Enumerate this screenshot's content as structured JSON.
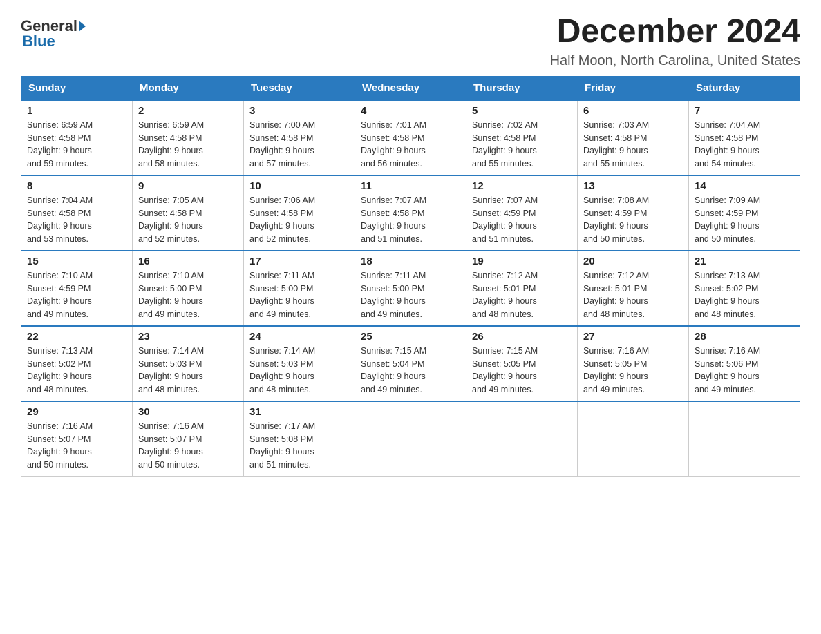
{
  "logo": {
    "general": "General",
    "blue": "Blue"
  },
  "title": {
    "month": "December 2024",
    "location": "Half Moon, North Carolina, United States"
  },
  "days_of_week": [
    "Sunday",
    "Monday",
    "Tuesday",
    "Wednesday",
    "Thursday",
    "Friday",
    "Saturday"
  ],
  "weeks": [
    [
      {
        "day": "1",
        "sunrise": "6:59 AM",
        "sunset": "4:58 PM",
        "daylight": "9 hours and 59 minutes."
      },
      {
        "day": "2",
        "sunrise": "6:59 AM",
        "sunset": "4:58 PM",
        "daylight": "9 hours and 58 minutes."
      },
      {
        "day": "3",
        "sunrise": "7:00 AM",
        "sunset": "4:58 PM",
        "daylight": "9 hours and 57 minutes."
      },
      {
        "day": "4",
        "sunrise": "7:01 AM",
        "sunset": "4:58 PM",
        "daylight": "9 hours and 56 minutes."
      },
      {
        "day": "5",
        "sunrise": "7:02 AM",
        "sunset": "4:58 PM",
        "daylight": "9 hours and 55 minutes."
      },
      {
        "day": "6",
        "sunrise": "7:03 AM",
        "sunset": "4:58 PM",
        "daylight": "9 hours and 55 minutes."
      },
      {
        "day": "7",
        "sunrise": "7:04 AM",
        "sunset": "4:58 PM",
        "daylight": "9 hours and 54 minutes."
      }
    ],
    [
      {
        "day": "8",
        "sunrise": "7:04 AM",
        "sunset": "4:58 PM",
        "daylight": "9 hours and 53 minutes."
      },
      {
        "day": "9",
        "sunrise": "7:05 AM",
        "sunset": "4:58 PM",
        "daylight": "9 hours and 52 minutes."
      },
      {
        "day": "10",
        "sunrise": "7:06 AM",
        "sunset": "4:58 PM",
        "daylight": "9 hours and 52 minutes."
      },
      {
        "day": "11",
        "sunrise": "7:07 AM",
        "sunset": "4:58 PM",
        "daylight": "9 hours and 51 minutes."
      },
      {
        "day": "12",
        "sunrise": "7:07 AM",
        "sunset": "4:59 PM",
        "daylight": "9 hours and 51 minutes."
      },
      {
        "day": "13",
        "sunrise": "7:08 AM",
        "sunset": "4:59 PM",
        "daylight": "9 hours and 50 minutes."
      },
      {
        "day": "14",
        "sunrise": "7:09 AM",
        "sunset": "4:59 PM",
        "daylight": "9 hours and 50 minutes."
      }
    ],
    [
      {
        "day": "15",
        "sunrise": "7:10 AM",
        "sunset": "4:59 PM",
        "daylight": "9 hours and 49 minutes."
      },
      {
        "day": "16",
        "sunrise": "7:10 AM",
        "sunset": "5:00 PM",
        "daylight": "9 hours and 49 minutes."
      },
      {
        "day": "17",
        "sunrise": "7:11 AM",
        "sunset": "5:00 PM",
        "daylight": "9 hours and 49 minutes."
      },
      {
        "day": "18",
        "sunrise": "7:11 AM",
        "sunset": "5:00 PM",
        "daylight": "9 hours and 49 minutes."
      },
      {
        "day": "19",
        "sunrise": "7:12 AM",
        "sunset": "5:01 PM",
        "daylight": "9 hours and 48 minutes."
      },
      {
        "day": "20",
        "sunrise": "7:12 AM",
        "sunset": "5:01 PM",
        "daylight": "9 hours and 48 minutes."
      },
      {
        "day": "21",
        "sunrise": "7:13 AM",
        "sunset": "5:02 PM",
        "daylight": "9 hours and 48 minutes."
      }
    ],
    [
      {
        "day": "22",
        "sunrise": "7:13 AM",
        "sunset": "5:02 PM",
        "daylight": "9 hours and 48 minutes."
      },
      {
        "day": "23",
        "sunrise": "7:14 AM",
        "sunset": "5:03 PM",
        "daylight": "9 hours and 48 minutes."
      },
      {
        "day": "24",
        "sunrise": "7:14 AM",
        "sunset": "5:03 PM",
        "daylight": "9 hours and 48 minutes."
      },
      {
        "day": "25",
        "sunrise": "7:15 AM",
        "sunset": "5:04 PM",
        "daylight": "9 hours and 49 minutes."
      },
      {
        "day": "26",
        "sunrise": "7:15 AM",
        "sunset": "5:05 PM",
        "daylight": "9 hours and 49 minutes."
      },
      {
        "day": "27",
        "sunrise": "7:16 AM",
        "sunset": "5:05 PM",
        "daylight": "9 hours and 49 minutes."
      },
      {
        "day": "28",
        "sunrise": "7:16 AM",
        "sunset": "5:06 PM",
        "daylight": "9 hours and 49 minutes."
      }
    ],
    [
      {
        "day": "29",
        "sunrise": "7:16 AM",
        "sunset": "5:07 PM",
        "daylight": "9 hours and 50 minutes."
      },
      {
        "day": "30",
        "sunrise": "7:16 AM",
        "sunset": "5:07 PM",
        "daylight": "9 hours and 50 minutes."
      },
      {
        "day": "31",
        "sunrise": "7:17 AM",
        "sunset": "5:08 PM",
        "daylight": "9 hours and 51 minutes."
      },
      null,
      null,
      null,
      null
    ]
  ],
  "labels": {
    "sunrise": "Sunrise:",
    "sunset": "Sunset:",
    "daylight": "Daylight:"
  }
}
